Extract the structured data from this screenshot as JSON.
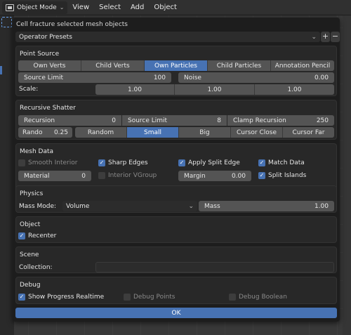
{
  "topbar": {
    "mode_label": "Object Mode",
    "menus": [
      "View",
      "Select",
      "Add",
      "Object"
    ]
  },
  "dialog": {
    "title": "Cell fracture selected mesh objects",
    "presets_label": "Operator Presets",
    "add_preset": "+",
    "remove_preset": "−",
    "ok_label": "OK"
  },
  "point_source": {
    "title": "Point Source",
    "options": [
      "Own Verts",
      "Child Verts",
      "Own Particles",
      "Child Particles",
      "Annotation Pencil"
    ],
    "active_option": "Own Particles",
    "source_limit_label": "Source Limit",
    "source_limit_value": "100",
    "noise_label": "Noise",
    "noise_value": "0.00",
    "scale_label": "Scale:",
    "scale_values": [
      "1.00",
      "1.00",
      "1.00"
    ]
  },
  "recursive_shatter": {
    "title": "Recursive Shatter",
    "recursion_label": "Recursion",
    "recursion_value": "0",
    "source_limit_label": "Source Limit",
    "source_limit_value": "8",
    "clamp_label": "Clamp Recursion",
    "clamp_value": "250",
    "rando_label": "Rando",
    "rando_value": "0.25",
    "modes": [
      "Random",
      "Small",
      "Big",
      "Cursor Close",
      "Cursor Far"
    ],
    "active_mode": "Small"
  },
  "mesh_data": {
    "title": "Mesh Data",
    "smooth_interior": {
      "label": "Smooth Interior",
      "checked": false
    },
    "sharp_edges": {
      "label": "Sharp Edges",
      "checked": true
    },
    "apply_split_edge": {
      "label": "Apply Split Edge",
      "checked": true
    },
    "match_data": {
      "label": "Match Data",
      "checked": true
    },
    "material_label": "Material",
    "material_value": "0",
    "interior_vgroup": {
      "label": "Interior VGroup",
      "checked": false
    },
    "margin_label": "Margin",
    "margin_value": "0.00",
    "split_islands": {
      "label": "Split Islands",
      "checked": true
    }
  },
  "physics": {
    "title": "Physics",
    "mass_mode_label": "Mass Mode:",
    "mass_mode_value": "Volume",
    "mass_label": "Mass",
    "mass_value": "1.00"
  },
  "object": {
    "title": "Object",
    "recenter": {
      "label": "Recenter",
      "checked": true
    }
  },
  "scene": {
    "title": "Scene",
    "collection_label": "Collection:",
    "collection_value": ""
  },
  "debug": {
    "title": "Debug",
    "show_progress": {
      "label": "Show Progress Realtime",
      "checked": true
    },
    "debug_points": {
      "label": "Debug Points",
      "checked": false
    },
    "debug_boolean": {
      "label": "Debug Boolean",
      "checked": false
    }
  },
  "colors": {
    "accent": "#4772b3",
    "panel": "#282828",
    "field": "#545454",
    "dialog_bg": "#1d1d1d"
  }
}
